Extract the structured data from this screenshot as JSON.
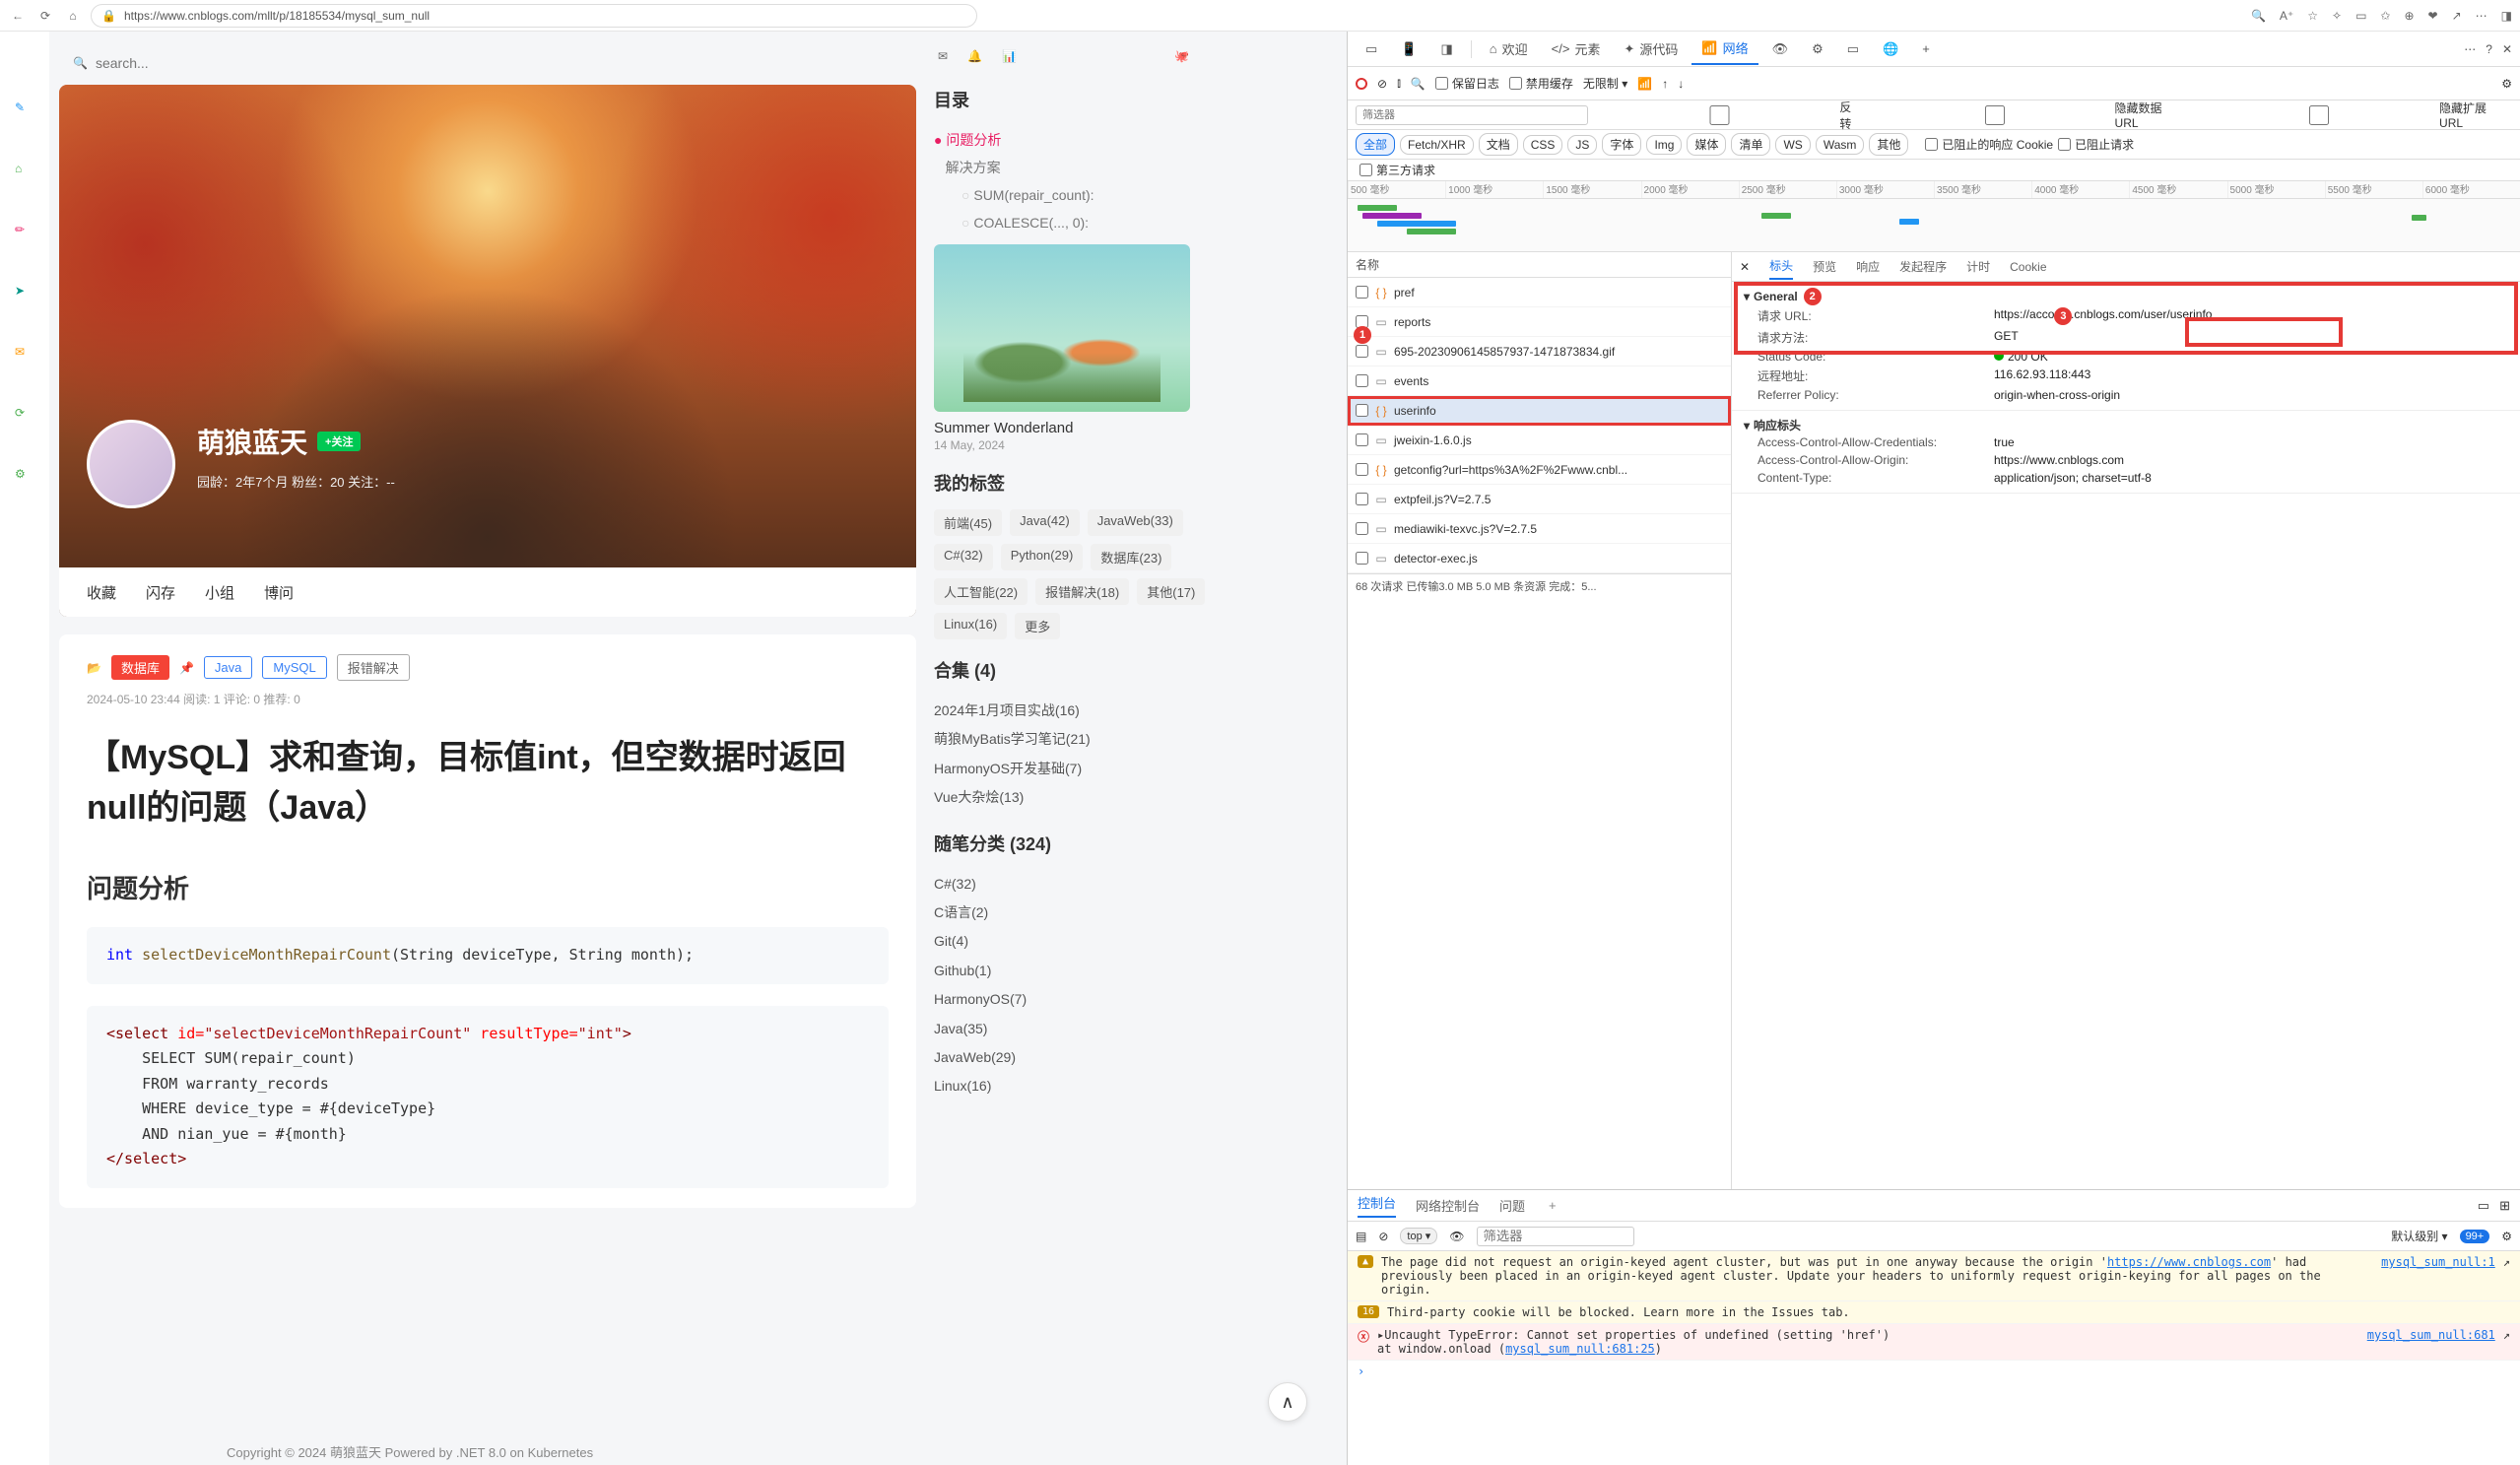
{
  "browser": {
    "url": "https://www.cnblogs.com/mllt/p/18185534/mysql_sum_null"
  },
  "blog": {
    "search_placeholder": "search...",
    "author": "萌狼蓝天",
    "follow": "+关注",
    "meta": "园龄：2年7个月   粉丝：20   关注：--",
    "tabs": [
      "收藏",
      "闪存",
      "小组",
      "博问"
    ],
    "card": {
      "folder_icon": "📂",
      "db": "数据库",
      "pin": "📌",
      "java": "Java",
      "mysql": "MySQL",
      "tag": "报错解决",
      "time": "2024-05-10 23:44   阅读: 1  评论: 0  推荐: 0",
      "title": "【MySQL】求和查询，目标值int，但空数据时返回null的问题（Java）",
      "section": "问题分析",
      "code1_int": "int",
      "code1_fn": "selectDeviceMonthRepairCount",
      "code1_args": "(String deviceType, String month);",
      "code2": {
        "l1a": "<select",
        "l1b": " id=",
        "l1c": "\"selectDeviceMonthRepairCount\"",
        "l1d": " resultType=",
        "l1e": "\"int\"",
        "l1f": ">",
        "l2": "    SELECT SUM(repair_count)",
        "l3": "    FROM warranty_records",
        "l4": "    WHERE device_type = #{deviceType}",
        "l5": "    AND nian_yue = #{month}",
        "l6": "</select>"
      }
    },
    "copyright": "Copyright © 2024 萌狼蓝天   Powered by .NET 8.0 on Kubernetes",
    "sidebar": {
      "toc_h": "目录",
      "toc": {
        "a": "问题分析",
        "b": "解决方案",
        "c": "SUM(repair_count):",
        "d": "COALESCE(..., 0):"
      },
      "widget_title": "Summer Wonderland",
      "widget_sub": "14 May, 2024",
      "tags_h": "我的标签",
      "tags": [
        "前端(45)",
        "Java(42)",
        "JavaWeb(33)",
        "C#(32)",
        "Python(29)",
        "数据库(23)",
        "人工智能(22)",
        "报错解决(18)",
        "其他(17)",
        "Linux(16)",
        "更多"
      ],
      "cat_h": "合集 (4)",
      "cats": [
        "2024年1月项目实战(16)",
        "萌狼MyBatis学习笔记(21)",
        "HarmonyOS开发基础(7)",
        "Vue大杂烩(13)"
      ],
      "cat2_h": "随笔分类 (324)",
      "cats2": [
        "C#(32)",
        "C语言(2)",
        "Git(4)",
        "Github(1)",
        "HarmonyOS(7)",
        "Java(35)",
        "JavaWeb(29)",
        "Linux(16)"
      ]
    }
  },
  "devtools": {
    "tabs": {
      "welcome": "欢迎",
      "elements": "元素",
      "sources": "源代码",
      "network": "网络"
    },
    "toolbar": {
      "keeplog": "保留日志",
      "nocache": "禁用缓存",
      "nolimit": "无限制"
    },
    "filter": {
      "placeholder": "筛选器",
      "reverse": "反转",
      "hidedata": "隐藏数据 URL",
      "hideext": "隐藏扩展 URL"
    },
    "types": [
      "全部",
      "Fetch/XHR",
      "文档",
      "CSS",
      "JS",
      "字体",
      "Img",
      "媒体",
      "清单",
      "WS",
      "Wasm",
      "其他"
    ],
    "types_cb1": "已阻止的响应 Cookie",
    "types_cb2": "已阻止请求",
    "third_party": "第三方请求",
    "timeline_ticks": [
      "500 毫秒",
      "1000 毫秒",
      "1500 毫秒",
      "2000 毫秒",
      "2500 毫秒",
      "3000 毫秒",
      "3500 毫秒",
      "4000 毫秒",
      "4500 毫秒",
      "5000 毫秒",
      "5500 毫秒",
      "6000 毫秒"
    ],
    "list_header": "名称",
    "requests": [
      {
        "icon": "{}",
        "name": "pref"
      },
      {
        "icon": "▭",
        "name": "reports"
      },
      {
        "icon": "▭",
        "name": "695-20230906145857937-1471873834.gif"
      },
      {
        "icon": "▭",
        "name": "events"
      },
      {
        "icon": "{}",
        "name": "userinfo",
        "sel": true
      },
      {
        "icon": "▭",
        "name": "jweixin-1.6.0.js"
      },
      {
        "icon": "{}",
        "name": "getconfig?url=https%3A%2F%2Fwww.cnbl..."
      },
      {
        "icon": "▭",
        "name": "extpfeil.js?V=2.7.5"
      },
      {
        "icon": "▭",
        "name": "mediawiki-texvc.js?V=2.7.5"
      },
      {
        "icon": "▭",
        "name": "detector-exec.js"
      }
    ],
    "status_line": "68 次请求   已传输3.0 MB   5.0 MB 条资源   完成：5...",
    "detail_tabs": [
      "标头",
      "预览",
      "响应",
      "发起程序",
      "计时",
      "Cookie"
    ],
    "general_h": "General",
    "kv": {
      "url_k": "请求 URL:",
      "url_v": "https://account.cnblogs.com/user/userinfo",
      "method_k": "请求方法:",
      "method_v": "GET",
      "status_k": "Status Code:",
      "status_v": "200 OK",
      "remote_k": "远程地址:",
      "remote_v": "116.62.93.118:443",
      "ref_k": "Referrer Policy:",
      "ref_v": "origin-when-cross-origin"
    },
    "resp_h": "响应标头",
    "resp": {
      "ac1_k": "Access-Control-Allow-Credentials:",
      "ac1_v": "true",
      "ac2_k": "Access-Control-Allow-Origin:",
      "ac2_v": "https://www.cnblogs.com",
      "ct_k": "Content-Type:",
      "ct_v": "application/json; charset=utf-8"
    }
  },
  "console": {
    "tabs": [
      "控制台",
      "网络控制台",
      "问题"
    ],
    "filter_ph": "筛选器",
    "level": "默认级别",
    "count": "99+",
    "top": "top",
    "msg1": "The page did not request an origin-keyed agent cluster, but was put in one anyway because the origin '",
    "msg1_url": "https://www.cnblogs.com",
    "msg1_tail": "' had previously been placed in an origin-keyed agent cluster. Update your headers to uniformly request origin-keying for all pages on the origin.",
    "msg1_src": "mysql_sum_null:1",
    "msg2_badge": "16",
    "msg2": "Third-party cookie will be blocked. Learn more in the Issues tab.",
    "msg3_a": "Uncaught TypeError: Cannot set properties of undefined (setting 'href')",
    "msg3_b": "    at window.onload (",
    "msg3_lnk": "mysql_sum_null:681:25",
    "msg3_c": ")",
    "msg3_src": "mysql_sum_null:681"
  }
}
